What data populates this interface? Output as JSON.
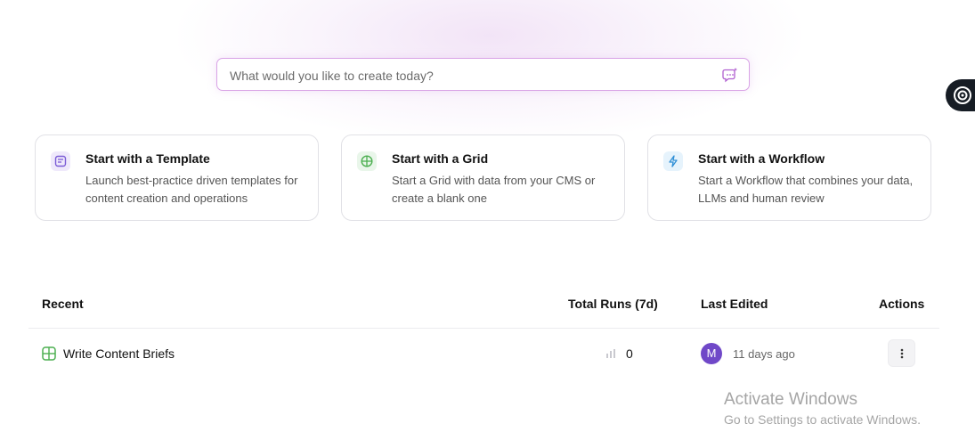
{
  "search": {
    "placeholder": "What would you like to create today?",
    "value": ""
  },
  "cards": [
    {
      "title": "Start with a Template",
      "description": "Launch best-practice driven templates for content creation and operations",
      "icon": "template-icon",
      "icon_color": "#7b5cd6",
      "icon_bg": "#efe9fb"
    },
    {
      "title": "Start with a Grid",
      "description": "Start a Grid with data from your CMS or create a blank one",
      "icon": "grid-icon",
      "icon_color": "#4caf50",
      "icon_bg": "#e9f6ea"
    },
    {
      "title": "Start with a Workflow",
      "description": "Start a Workflow that combines your data, LLMs and human review",
      "icon": "lightning-icon",
      "icon_color": "#2f8fd6",
      "icon_bg": "#e6f3fc"
    }
  ],
  "table": {
    "headers": {
      "recent": "Recent",
      "runs": "Total Runs (7d)",
      "edited": "Last Edited",
      "actions": "Actions"
    },
    "rows": [
      {
        "name": "Write Content Briefs",
        "icon": "grid-icon",
        "runs": "0",
        "avatar": "M",
        "avatar_color": "#7048c8",
        "edited": "11 days ago"
      }
    ]
  },
  "watermark": {
    "line1": "Activate Windows",
    "line2": "Go to Settings to activate Windows."
  },
  "colors": {
    "search_border": "#d9a3e6",
    "side_badge": "#161c24"
  }
}
